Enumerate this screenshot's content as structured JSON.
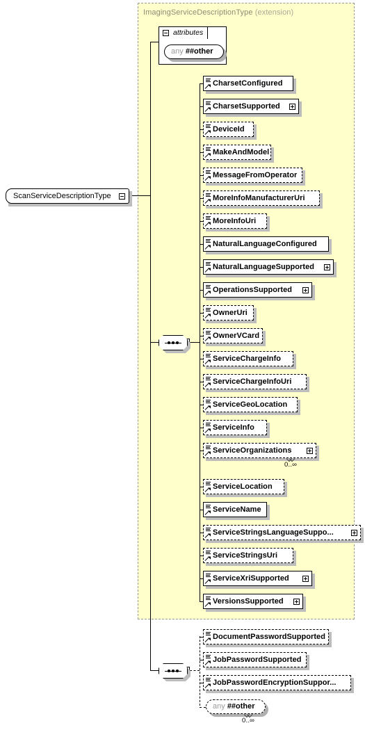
{
  "diagram": {
    "root": {
      "label": "ScanServiceDescriptionType",
      "toggle": "minus-box"
    },
    "extension": {
      "type_name": "ImagingServiceDescriptionType",
      "kind": "(extension)"
    },
    "attributes_group": {
      "label": "attributes",
      "toggle": "minus-box",
      "wildcard": {
        "keyword": "any",
        "namespace": "##other"
      }
    },
    "sequence_symbol": "sequence",
    "inherited_sequence": {
      "elements": [
        {
          "name": "CharsetConfigured",
          "optional": false,
          "expandable": false,
          "occurs": ""
        },
        {
          "name": "CharsetSupported",
          "optional": false,
          "expandable": true,
          "occurs": ""
        },
        {
          "name": "DeviceId",
          "optional": true,
          "expandable": false,
          "occurs": ""
        },
        {
          "name": "MakeAndModel",
          "optional": true,
          "expandable": false,
          "occurs": ""
        },
        {
          "name": "MessageFromOperator",
          "optional": true,
          "expandable": false,
          "occurs": ""
        },
        {
          "name": "MoreInfoManufacturerUri",
          "optional": true,
          "expandable": false,
          "occurs": ""
        },
        {
          "name": "MoreInfoUri",
          "optional": true,
          "expandable": false,
          "occurs": ""
        },
        {
          "name": "NaturalLanguageConfigured",
          "optional": false,
          "expandable": false,
          "occurs": ""
        },
        {
          "name": "NaturalLanguageSupported",
          "optional": false,
          "expandable": true,
          "occurs": ""
        },
        {
          "name": "OperationsSupported",
          "optional": false,
          "expandable": true,
          "occurs": ""
        },
        {
          "name": "OwnerUri",
          "optional": true,
          "expandable": false,
          "occurs": ""
        },
        {
          "name": "OwnerVCard",
          "optional": true,
          "expandable": false,
          "occurs": ""
        },
        {
          "name": "ServiceChargeInfo",
          "optional": true,
          "expandable": false,
          "occurs": ""
        },
        {
          "name": "ServiceChargeInfoUri",
          "optional": true,
          "expandable": false,
          "occurs": ""
        },
        {
          "name": "ServiceGeoLocation",
          "optional": true,
          "expandable": false,
          "occurs": ""
        },
        {
          "name": "ServiceInfo",
          "optional": true,
          "expandable": false,
          "occurs": ""
        },
        {
          "name": "ServiceOrganizations",
          "optional": true,
          "expandable": true,
          "occurs": "0..∞"
        },
        {
          "name": "ServiceLocation",
          "optional": true,
          "expandable": false,
          "occurs": ""
        },
        {
          "name": "ServiceName",
          "optional": false,
          "expandable": false,
          "occurs": ""
        },
        {
          "name": "ServiceStringsLanguageSuppo...",
          "optional": true,
          "expandable": true,
          "occurs": ""
        },
        {
          "name": "ServiceStringsUri",
          "optional": true,
          "expandable": false,
          "occurs": ""
        },
        {
          "name": "ServiceXriSupported",
          "optional": false,
          "expandable": true,
          "occurs": ""
        },
        {
          "name": "VersionsSupported",
          "optional": false,
          "expandable": true,
          "occurs": ""
        }
      ]
    },
    "own_sequence": {
      "elements": [
        {
          "name": "DocumentPasswordSupported",
          "optional": true,
          "expandable": false,
          "occurs": ""
        },
        {
          "name": "JobPasswordSupported",
          "optional": true,
          "expandable": false,
          "occurs": ""
        },
        {
          "name": "JobPasswordEncryptionSuppor...",
          "optional": true,
          "expandable": false,
          "occurs": ""
        }
      ],
      "wildcard": {
        "keyword": "any",
        "namespace": "##other",
        "occurs": "0..∞"
      }
    },
    "colors": {
      "extension_background": "#ffffcc",
      "extension_border": "#999999",
      "box_background": "#ffffff",
      "box_border": "#000000",
      "shadow": "#bdbdbd",
      "title_text": "#8c8c74",
      "wildcard_keyword": "#999999"
    }
  }
}
